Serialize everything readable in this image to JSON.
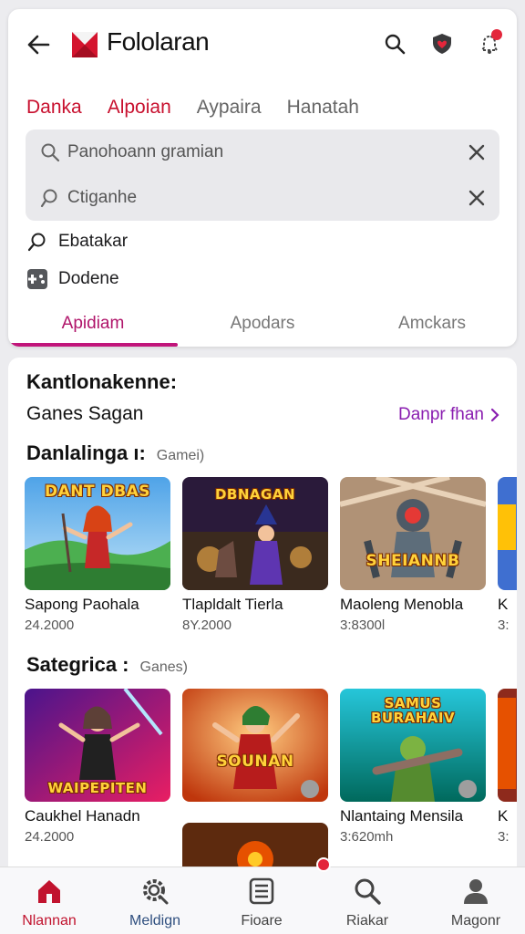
{
  "header": {
    "title": "Fololaran",
    "icons": [
      "back-arrow-icon",
      "brand-logo",
      "search-icon",
      "shield-heart-icon",
      "notification-bell-icon"
    ]
  },
  "categories": [
    "Danka",
    "Alpoian",
    "Aypaira",
    "Hanatah"
  ],
  "search": {
    "query": "Panohoann gramian",
    "secondary_query": "Ctiganhe"
  },
  "suggestions": [
    {
      "label": "Ebatakar",
      "icon": "search-icon"
    },
    {
      "label": "Dodene",
      "icon": "gamepad-icon"
    }
  ],
  "tabs": [
    "Apidiam",
    "Apodars",
    "Amckars"
  ],
  "main": {
    "heading": "Kantlonakenne:",
    "subheading": "Ganes Sagan",
    "see_all": "Danpr fhan",
    "rows": [
      {
        "title": "Danlalinga ı:",
        "subtitle": "Gamei)",
        "games": [
          {
            "name": "Sapong Paohala",
            "meta": "24.2000",
            "thumb_text": "DANT DBAS"
          },
          {
            "name": "Tlapldalt Tierla",
            "meta": "8Y.2000",
            "thumb_text": "DBNAGAN"
          },
          {
            "name": "Maoleng Menobla",
            "meta": "3:8300l",
            "thumb_text": "SHEIANNB"
          },
          {
            "name": "K",
            "meta": "3:",
            "thumb_text": ""
          }
        ]
      },
      {
        "title": "Sategrica :",
        "subtitle": "Ganes)",
        "games": [
          {
            "name": "Caukhel Hanadn",
            "meta": "24.2000",
            "thumb_text": "WAIPEPITEN"
          },
          {
            "name": "",
            "meta": "",
            "thumb_text": "SOUNAN"
          },
          {
            "name": "Nlantaing Mensila",
            "meta": "3:620mh",
            "thumb_text": "SAMUS BURAHAIV"
          },
          {
            "name": "K",
            "meta": "3:",
            "thumb_text": ""
          }
        ]
      }
    ]
  },
  "bottom_nav": [
    {
      "label": "Nlannan",
      "icon": "home-icon"
    },
    {
      "label": "Meldign",
      "icon": "gear-search-icon"
    },
    {
      "label": "Fioare",
      "icon": "library-icon"
    },
    {
      "label": "Riakar",
      "icon": "search-icon"
    },
    {
      "label": "Magonr",
      "icon": "profile-icon"
    }
  ],
  "colors": {
    "accent": "#c1157a",
    "primary_red": "#c8102e",
    "purple_link": "#8a1eb0",
    "active_cat": "#c8102e"
  }
}
